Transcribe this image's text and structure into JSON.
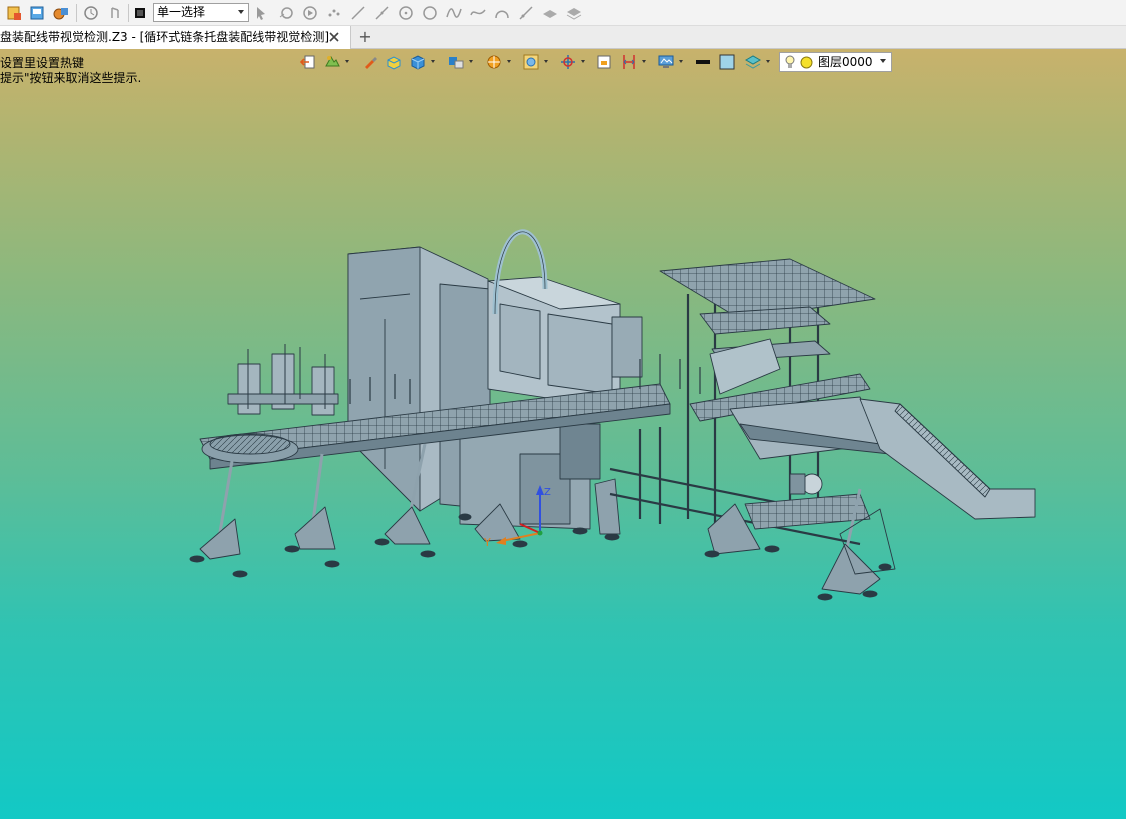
{
  "toolbar": {
    "select_mode_value": "单一选择"
  },
  "tab": {
    "title": "盘装配线带视觉检测.Z3 - [循环式链条托盘装配线带视觉检测]",
    "new_tab": "+"
  },
  "viewport": {
    "hint_line1": "设置里设置热键",
    "hint_line2": "提示\"按钮来取消这些提示.",
    "layer_value": "图层0000",
    "axis_x_label": "Y",
    "axis_z_label": "Z"
  },
  "colors": {
    "gradient_top": "#c8b26c",
    "gradient_bottom": "#12c9c5",
    "model_fill": "#8fa7b3",
    "model_edge": "#2a3a44"
  }
}
